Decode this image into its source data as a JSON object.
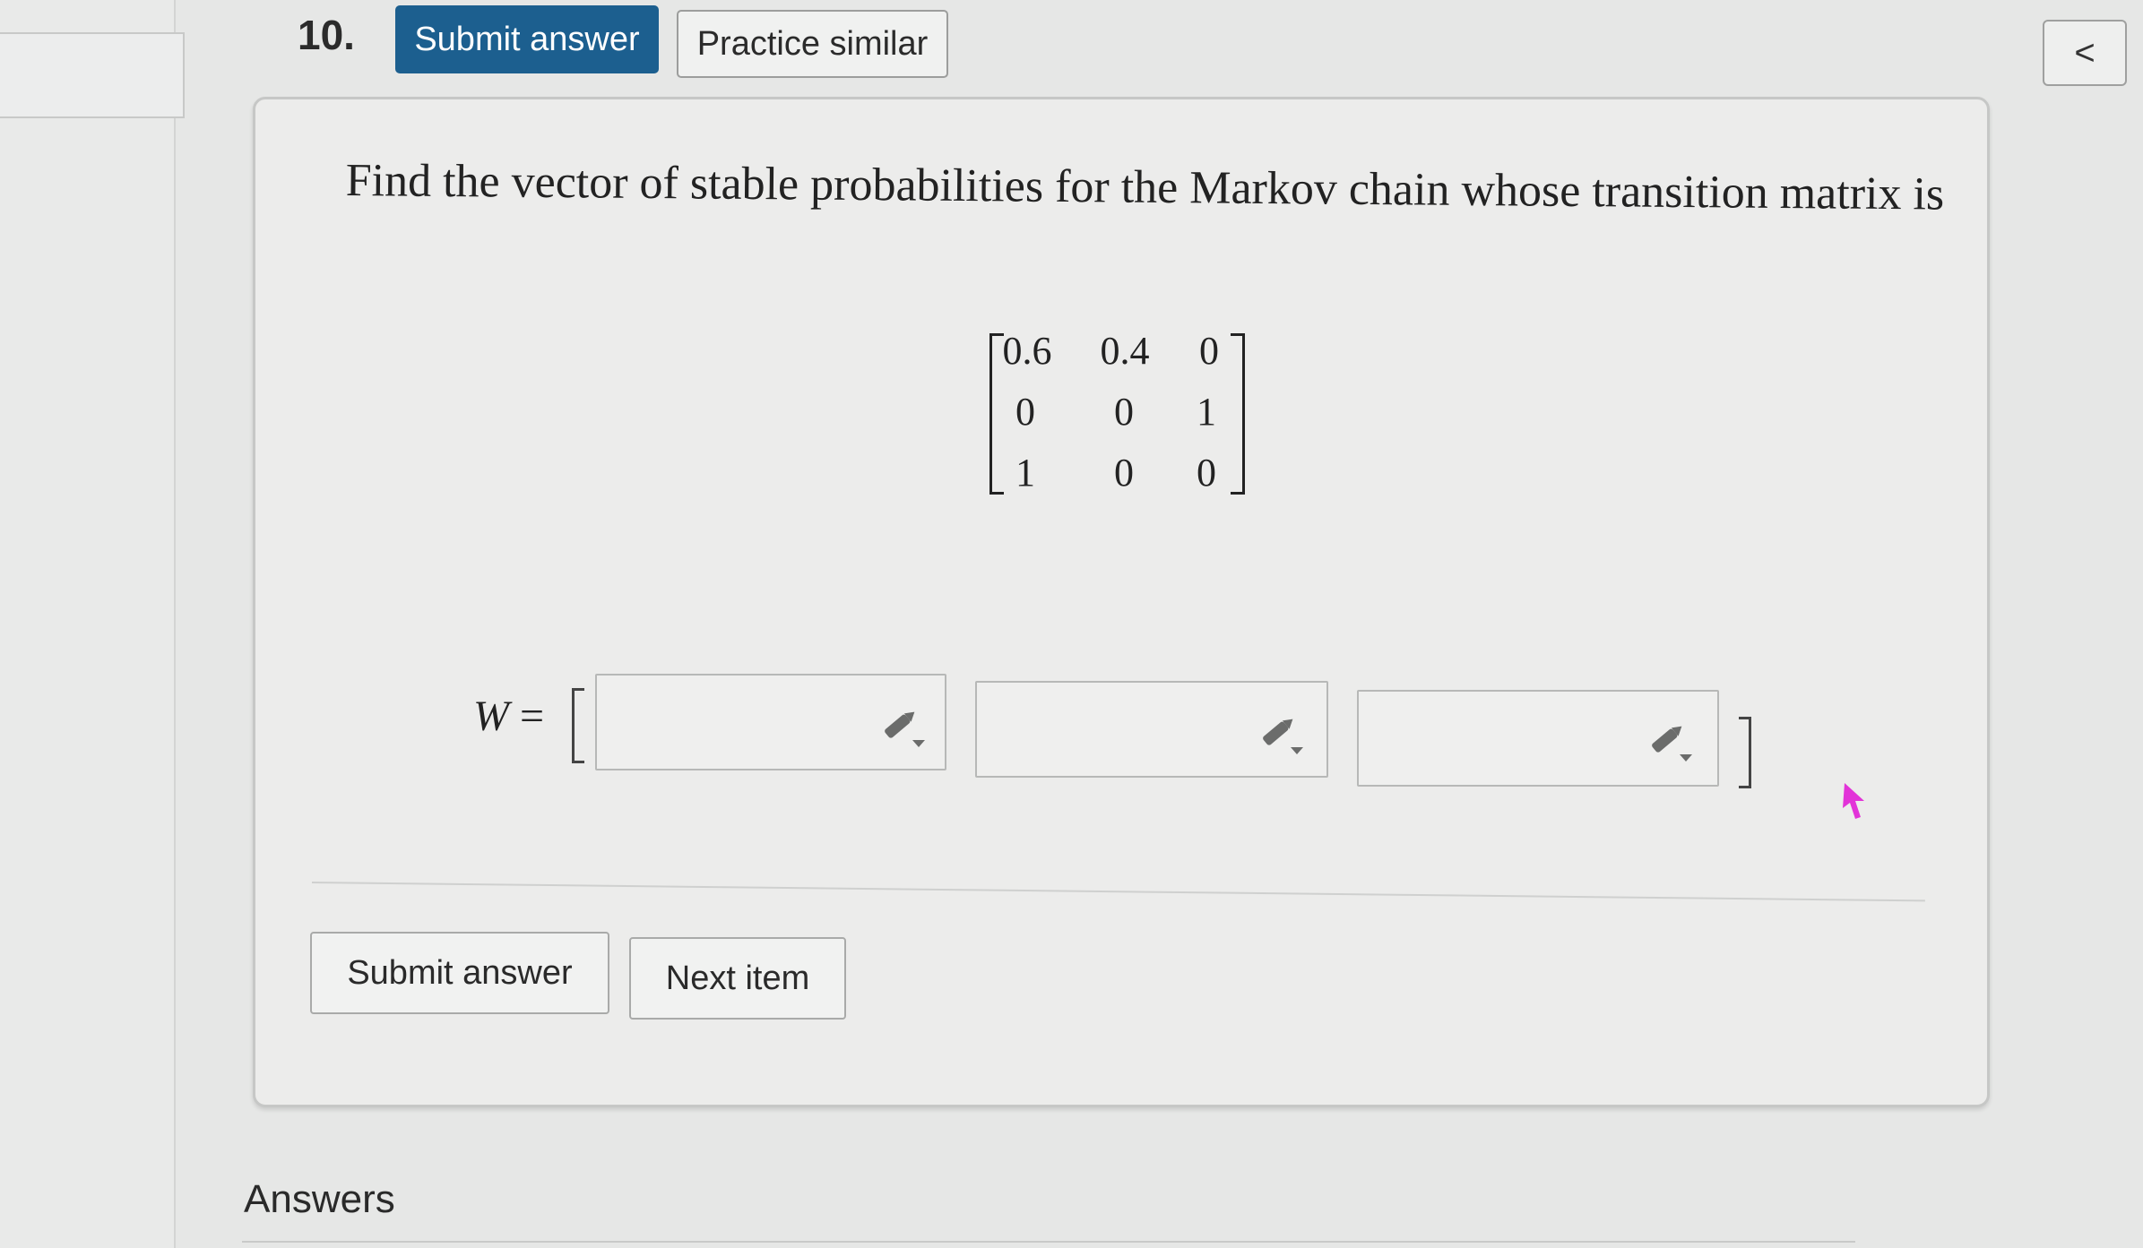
{
  "question": {
    "number": "10.",
    "prompt": "Find the vector of stable probabilities for the Markov chain whose transition matrix is",
    "matrix": [
      [
        "0.6",
        "0.4",
        "0"
      ],
      [
        "0",
        "0",
        "1"
      ],
      [
        "1",
        "0",
        "0"
      ]
    ],
    "answer_label": "W",
    "answer_equals": "=",
    "answer_values": [
      "",
      "",
      ""
    ]
  },
  "toolbar": {
    "submit_label": "Submit answer",
    "practice_label": "Practice similar",
    "collapse_symbol": "<"
  },
  "footer": {
    "submit_label": "Submit answer",
    "next_label": "Next item"
  },
  "answers_section": {
    "heading": "Answers"
  },
  "colors": {
    "primary_button": "#1c5f8f",
    "background": "#e6e7e6",
    "card": "#ececeb",
    "cursor": "#e233d8"
  },
  "icons": [
    "pencil-dropdown-icon",
    "chevron-left-icon",
    "mouse-cursor-icon"
  ]
}
